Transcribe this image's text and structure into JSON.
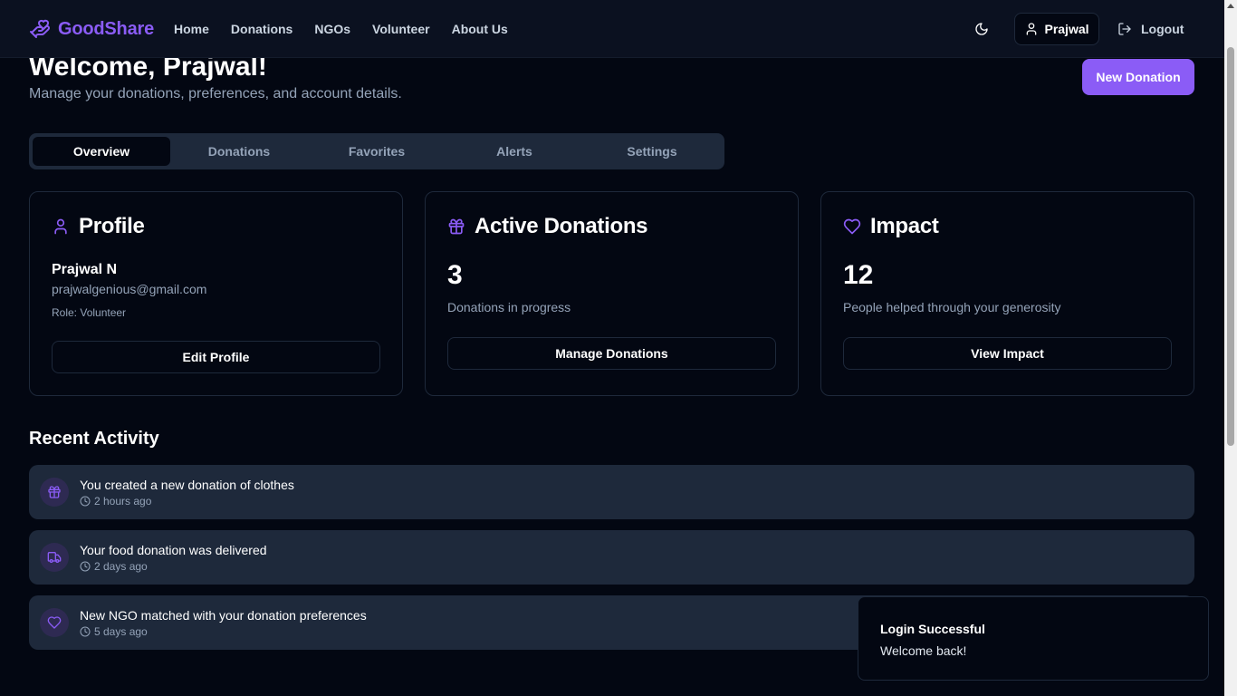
{
  "navbar": {
    "brand": "GoodShare",
    "brand_icon": "hand-heart-icon",
    "links": [
      "Home",
      "Donations",
      "NGOs",
      "Volunteer",
      "About Us"
    ],
    "theme_icon": "moon-icon",
    "user_label": "Prajwal",
    "logout_label": "Logout"
  },
  "header": {
    "title": "Welcome, Prajwal!",
    "subtitle": "Manage your donations, preferences, and account details.",
    "new_donation_label": "New Donation"
  },
  "tabs": [
    {
      "label": "Overview",
      "active": true
    },
    {
      "label": "Donations",
      "active": false
    },
    {
      "label": "Favorites",
      "active": false
    },
    {
      "label": "Alerts",
      "active": false
    },
    {
      "label": "Settings",
      "active": false
    }
  ],
  "profile_card": {
    "title": "Profile",
    "icon": "user-icon",
    "name": "Prajwal N",
    "email": "prajwalgenious@gmail.com",
    "role": "Role: Volunteer",
    "button": "Edit Profile"
  },
  "donations_card": {
    "title": "Active Donations",
    "icon": "gift-icon",
    "count": "3",
    "note": "Donations in progress",
    "button": "Manage Donations"
  },
  "impact_card": {
    "title": "Impact",
    "icon": "heart-icon",
    "count": "12",
    "note": "People helped through your generosity",
    "button": "View Impact"
  },
  "recent_activity": {
    "title": "Recent Activity",
    "items": [
      {
        "icon": "gift-icon",
        "text": "You created a new donation of clothes",
        "time": "2 hours ago"
      },
      {
        "icon": "truck-icon",
        "text": "Your food donation was delivered",
        "time": "2 days ago"
      },
      {
        "icon": "heart-icon",
        "text": "New NGO matched with your donation preferences",
        "time": "5 days ago"
      }
    ]
  },
  "toast": {
    "title": "Login Successful",
    "message": "Welcome back!"
  },
  "colors": {
    "background": "#030712",
    "accent": "#8b5cf6",
    "surface": "#1e293b",
    "muted_text": "#94a3b8"
  }
}
